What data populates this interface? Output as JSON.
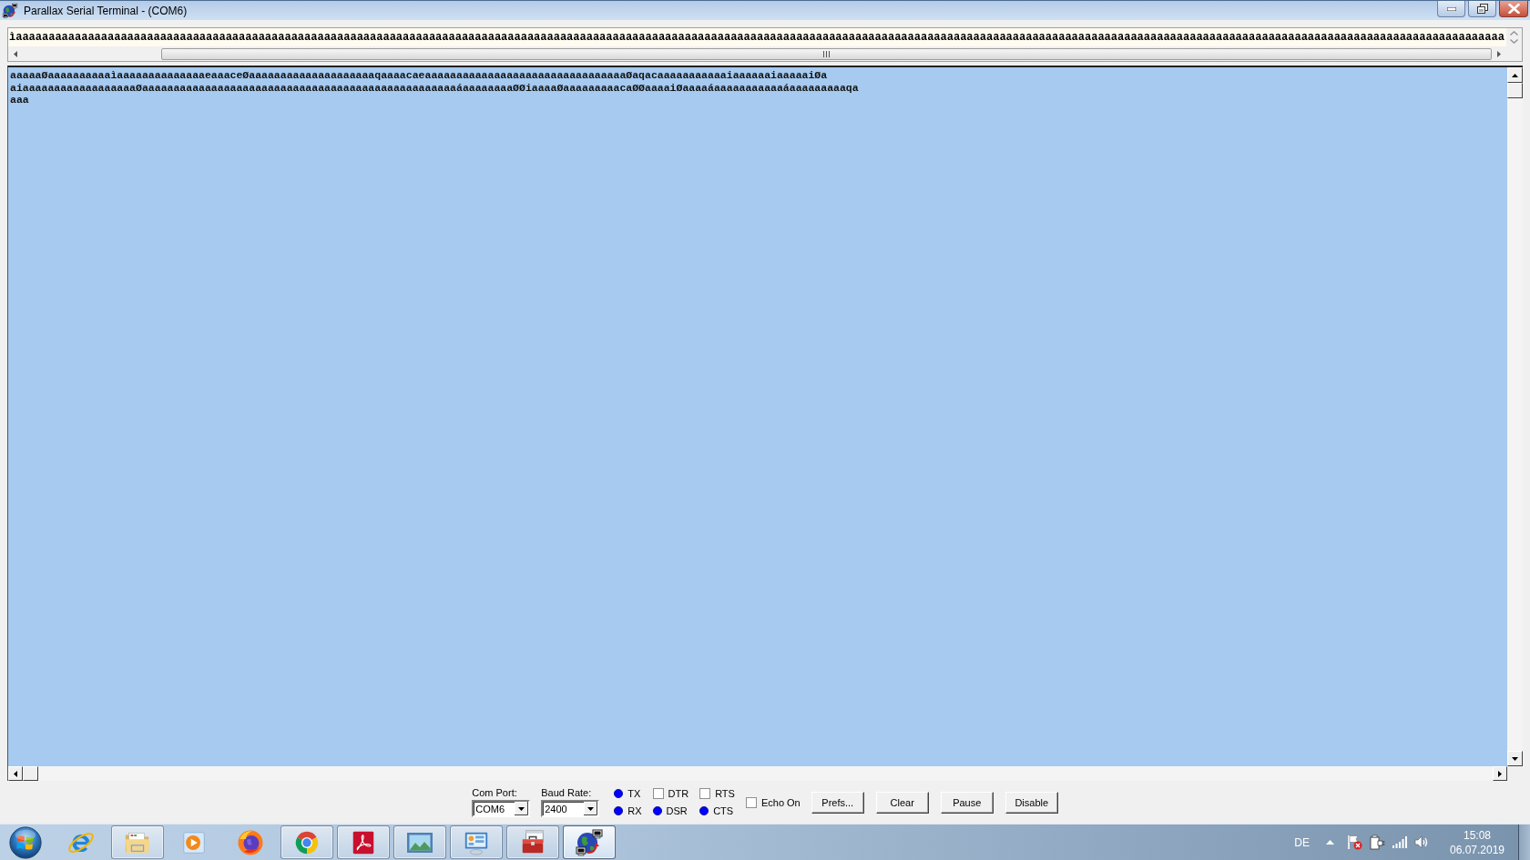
{
  "window": {
    "title": "Parallax Serial Terminal - (COM6)"
  },
  "transmit_line": {
    "value": "ìaaaaaaaaaaaaaaaaaaaaaaaaaaaaaaaaaaaaaaaaaaaaaaaaaaaaaaaaaaaaaaaaaaaaaaaaaaaaaaaaaaaaaaaaaaaaaaaaaaaaaaaaaaaaaaaaaaaaaaaaaaaaaaaaaaaaaaaaaaaaaaaaaaaaaaaaaaaaaaaaaaaaaaaaaaaaaaaaaaaaaaaaaaaaaaaaaaaaaaaaaaaaaaaaaaaaaaaaaaaaaaaaaaa"
  },
  "receive_pane": {
    "lines": [
      "aaaaaØaaaaaaaaaaìaaaaaaaaaaaaaaeaaaceØaaaaaaaaaaaaaaaaaaaaqaaaacaeaaaaaaaaaaaaaaaaaaaaaaaaaaaaaaaaØaqacaaaaaaaaaaaiaaaaaaiaaaaaiØa",
      "aiaaaaaaaaaaaaaaaaaaØaaaaaaaaaaaaaaaaaaaaaaaaaaaaaaaaaaaaaaaaaaaaaaaaaaáaaaaaaaaØØiaaaaØaaaaaaaaacaØØaaaaiØaaaaáaaaaaaaaaaaáaaaaaaaaaqa",
      "aaa"
    ]
  },
  "controls": {
    "com_port": {
      "label": "Com Port:",
      "value": "COM6"
    },
    "baud_rate": {
      "label": "Baud Rate:",
      "value": "2400"
    },
    "signals": [
      {
        "kind": "indicator",
        "label": "TX"
      },
      {
        "kind": "indicator",
        "label": "RX"
      },
      {
        "kind": "checkbox",
        "label": "DTR",
        "checked": false
      },
      {
        "kind": "indicator",
        "label": "DSR"
      },
      {
        "kind": "checkbox",
        "label": "RTS",
        "checked": false
      },
      {
        "kind": "indicator",
        "label": "CTS"
      }
    ],
    "echo": {
      "label": "Echo On",
      "checked": false
    },
    "buttons": [
      "Prefs...",
      "Clear",
      "Pause",
      "Disable"
    ]
  },
  "taskbar": {
    "apps": [
      {
        "kind": "ie",
        "running": false,
        "selected": false
      },
      {
        "kind": "explorer",
        "running": true,
        "selected": false
      },
      {
        "kind": "mediaplayer",
        "running": false,
        "selected": false
      },
      {
        "kind": "firefox",
        "running": false,
        "selected": false
      },
      {
        "kind": "chrome",
        "running": true,
        "selected": false
      },
      {
        "kind": "acrobat",
        "running": true,
        "selected": false
      },
      {
        "kind": "photoviewer",
        "running": true,
        "selected": false
      },
      {
        "kind": "controlpanel",
        "running": true,
        "selected": false
      },
      {
        "kind": "toolbox",
        "running": true,
        "selected": false
      },
      {
        "kind": "terminal",
        "running": true,
        "selected": true
      }
    ],
    "tray": {
      "language": "DE",
      "time": "15:08",
      "date": "06.07.2019"
    }
  }
}
